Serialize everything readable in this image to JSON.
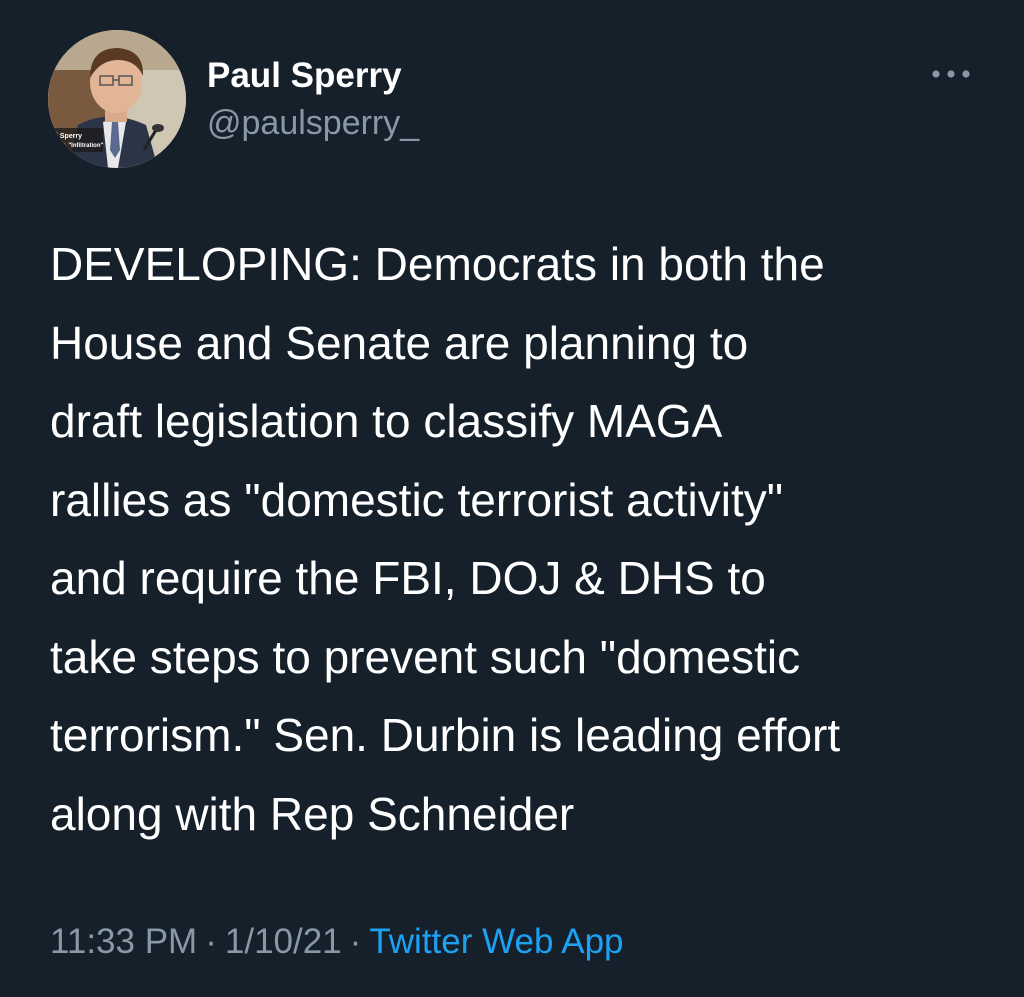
{
  "author": {
    "name": "Paul Sperry",
    "handle": "@paulsperry_",
    "avatar_caption_line1": "l Sperry",
    "avatar_caption_line2": "her, \"Infiltration\""
  },
  "more_icon": "more-horizontal-icon",
  "tweet": {
    "text": "DEVELOPING: Democrats in both the\nHouse and Senate are planning to\ndraft legislation to classify MAGA\nrallies as \"domestic terrorist activity\"\nand require the FBI, DOJ & DHS to\ntake steps to prevent such \"domestic\nterrorism.\" Sen. Durbin is leading effort\nalong with Rep Schneider",
    "time": "11:33 PM",
    "separator": "·",
    "date": "1/10/21",
    "source": "Twitter Web App"
  },
  "colors": {
    "background": "#15202b",
    "secondary_text": "#8899a6",
    "link": "#1da1f2"
  }
}
